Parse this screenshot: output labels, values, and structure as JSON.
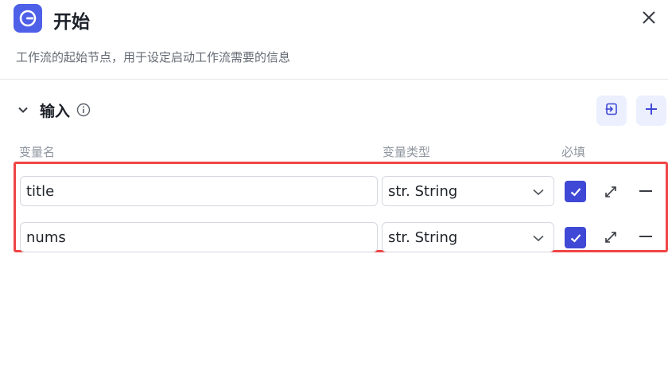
{
  "header": {
    "title": "开始",
    "description": "工作流的起始节点，用于设定启动工作流需要的信息"
  },
  "input_section": {
    "title": "输入"
  },
  "columns": {
    "name": "变量名",
    "type": "变量类型",
    "required": "必填"
  },
  "rows": [
    {
      "name": "title",
      "type": "str. String",
      "required": true
    },
    {
      "name": "nums",
      "type": "str. String",
      "required": true
    }
  ],
  "colors": {
    "accent": "#3f49d6",
    "app_icon": "#4e5fe8",
    "highlight": "#f04545",
    "tool_button_bg": "#eceffd"
  },
  "icons": {
    "app": "workflow-start-icon",
    "close": "close-icon",
    "collapse": "chevron-down-icon",
    "info": "info-icon",
    "import": "import-icon",
    "add": "plus-icon",
    "expand": "expand-icon",
    "remove": "minus-icon"
  }
}
